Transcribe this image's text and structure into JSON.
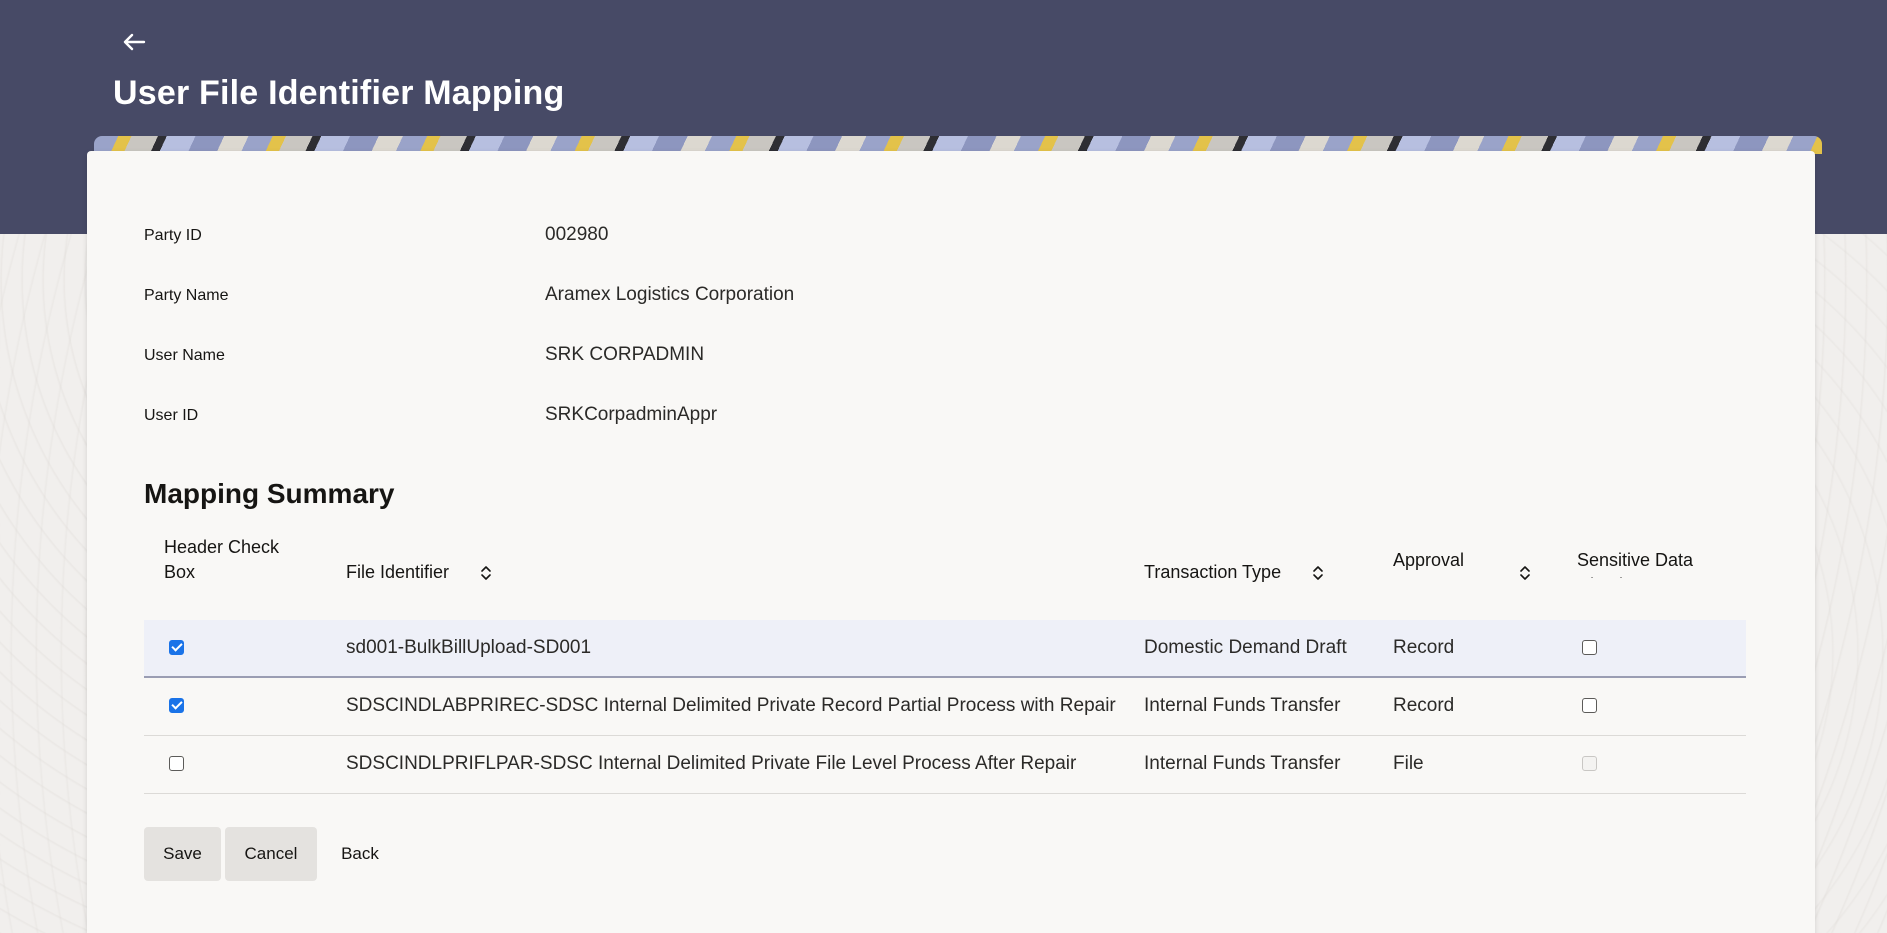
{
  "page": {
    "title": "User File Identifier Mapping",
    "back_icon": "arrow-left-icon"
  },
  "details": [
    {
      "label": "Party ID",
      "value": "002980"
    },
    {
      "label": "Party Name",
      "value": "Aramex Logistics Corporation"
    },
    {
      "label": "User Name",
      "value": "SRK CORPADMIN"
    },
    {
      "label": "User ID",
      "value": "SRKCorpadminAppr"
    }
  ],
  "summary": {
    "title": "Mapping Summary",
    "columns": {
      "header_checkbox": "Header Check Box",
      "file_identifier": "File Identifier",
      "transaction_type": "Transaction Type",
      "approval_type": "Approval Type",
      "sensitive_data": "Sensitive Data Check"
    },
    "rows": [
      {
        "checked": true,
        "file_identifier": "sd001-BulkBillUpload-SD001",
        "transaction_type": "Domestic Demand Draft",
        "approval_type": "Record",
        "sensitive": false,
        "sensitive_disabled": false
      },
      {
        "checked": true,
        "file_identifier": "SDSCINDLABPRIREC-SDSC Internal Delimited Private Record Partial Process with Repair",
        "transaction_type": "Internal Funds Transfer",
        "approval_type": "Record",
        "sensitive": false,
        "sensitive_disabled": false
      },
      {
        "checked": false,
        "file_identifier": "SDSCINDLPRIFLPAR-SDSC Internal Delimited Private File Level Process After Repair",
        "transaction_type": "Internal Funds Transfer",
        "approval_type": "File",
        "sensitive": false,
        "sensitive_disabled": true
      }
    ]
  },
  "buttons": {
    "save": "Save",
    "cancel": "Cancel",
    "back": "Back"
  },
  "colors": {
    "header": "#474a66",
    "checkbox_checked": "#1a73e8",
    "selected_row": "#eef0f8"
  }
}
